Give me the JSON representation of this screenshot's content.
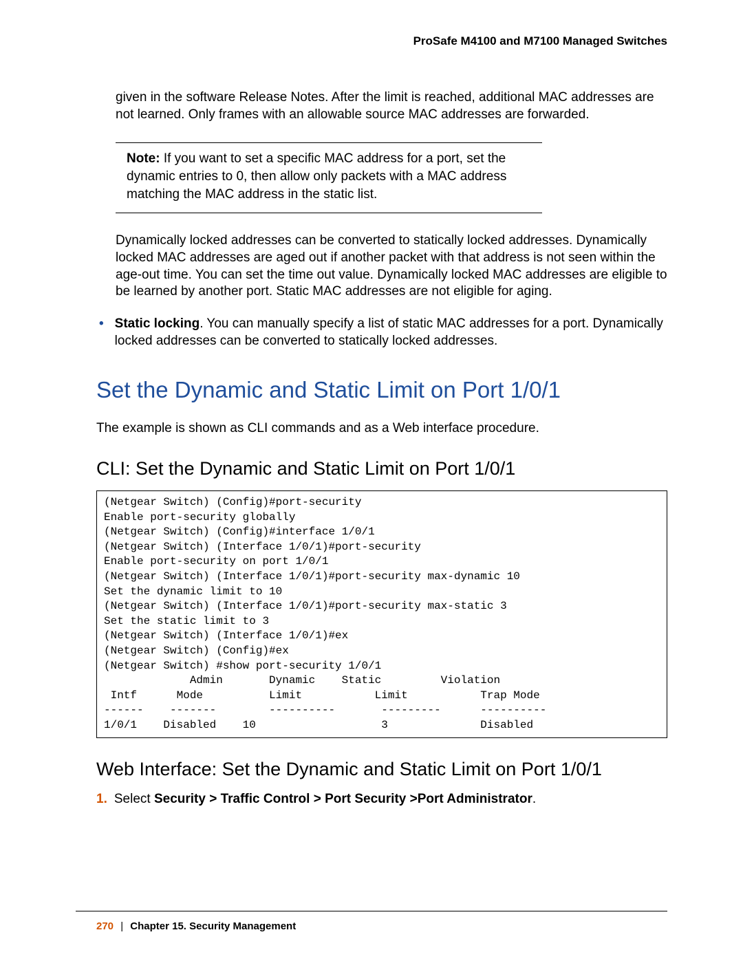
{
  "header": "ProSafe M4100 and M7100 Managed Switches",
  "para1": "given in the software Release Notes. After the limit is reached, additional MAC addresses are not learned. Only frames with an allowable source MAC addresses are forwarded.",
  "note": {
    "label": "Note:",
    "text": "If you want to set a specific MAC address for a port, set the dynamic entries to 0, then allow only packets with a MAC address matching the MAC address in the static list."
  },
  "para2": "Dynamically locked addresses can be converted to statically locked addresses. Dynamically locked MAC addresses are aged out if another packet with that address is not seen within the age-out time. You can set the time out value. Dynamically locked MAC addresses are eligible to be learned by another port. Static MAC addresses are not eligible for aging.",
  "bullet": {
    "lead": "Static locking",
    "rest": ". You can manually specify a list of static MAC addresses for a port. Dynamically locked addresses can be converted to statically locked addresses."
  },
  "h1": "Set the Dynamic and Static Limit on Port 1/0/1",
  "intro": "The example is shown as CLI commands and as a Web interface procedure.",
  "h2a": "CLI: Set the Dynamic and Static Limit on Port 1/0/1",
  "cli": "(Netgear Switch) (Config)#port-security\nEnable port-security globally\n(Netgear Switch) (Config)#interface 1/0/1\n(Netgear Switch) (Interface 1/0/1)#port-security\nEnable port-security on port 1/0/1\n(Netgear Switch) (Interface 1/0/1)#port-security max-dynamic 10\nSet the dynamic limit to 10\n(Netgear Switch) (Interface 1/0/1)#port-security max-static 3\nSet the static limit to 3\n(Netgear Switch) (Interface 1/0/1)#ex\n(Netgear Switch) (Config)#ex\n(Netgear Switch) #show port-security 1/0/1\n             Admin       Dynamic    Static         Violation\n Intf      Mode          Limit           Limit           Trap Mode\n------    -------        ----------       ---------      ----------\n1/0/1    Disabled    10                   3              Disabled",
  "h2b": "Web Interface: Set the Dynamic and Static Limit on Port 1/0/1",
  "step1": {
    "num": "1.",
    "pre": "Select ",
    "bold": "Security > Traffic Control > Port Security >Port Administrator",
    "post": "."
  },
  "footer": {
    "page": "270",
    "chapter": "Chapter 15.  Security Management"
  }
}
